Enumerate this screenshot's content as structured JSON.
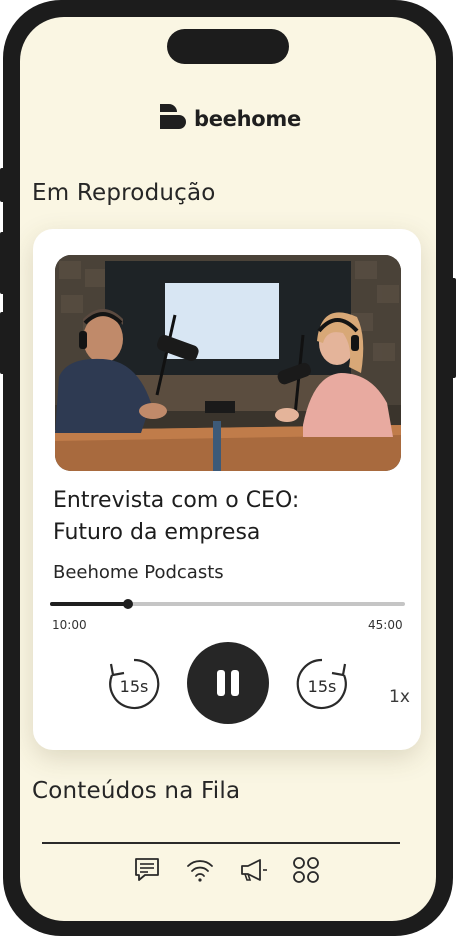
{
  "app": {
    "brand_name": "beehome",
    "brand_color": "#1f1f1f",
    "background_color": "#faf6e3"
  },
  "now_playing": {
    "section_title": "Em Reprodução",
    "cover_image": "podcast-studio-photo",
    "episode_title_line1": "Entrevista com o CEO:",
    "episode_title_line2": "Futuro da empresa",
    "podcast_name": "Beehome Podcasts",
    "progress_fraction": 0.22,
    "current_time": "10:00",
    "total_time": "45:00",
    "rewind_label": "15s",
    "forward_label": "15s",
    "play_state_icon": "pause-icon",
    "speed_label": "1x"
  },
  "queue": {
    "section_title": "Conteúdos na Fila"
  },
  "bottom_nav": {
    "items": [
      {
        "icon": "chat-icon"
      },
      {
        "icon": "wifi-icon"
      },
      {
        "icon": "megaphone-icon"
      },
      {
        "icon": "grid-icon"
      }
    ]
  }
}
